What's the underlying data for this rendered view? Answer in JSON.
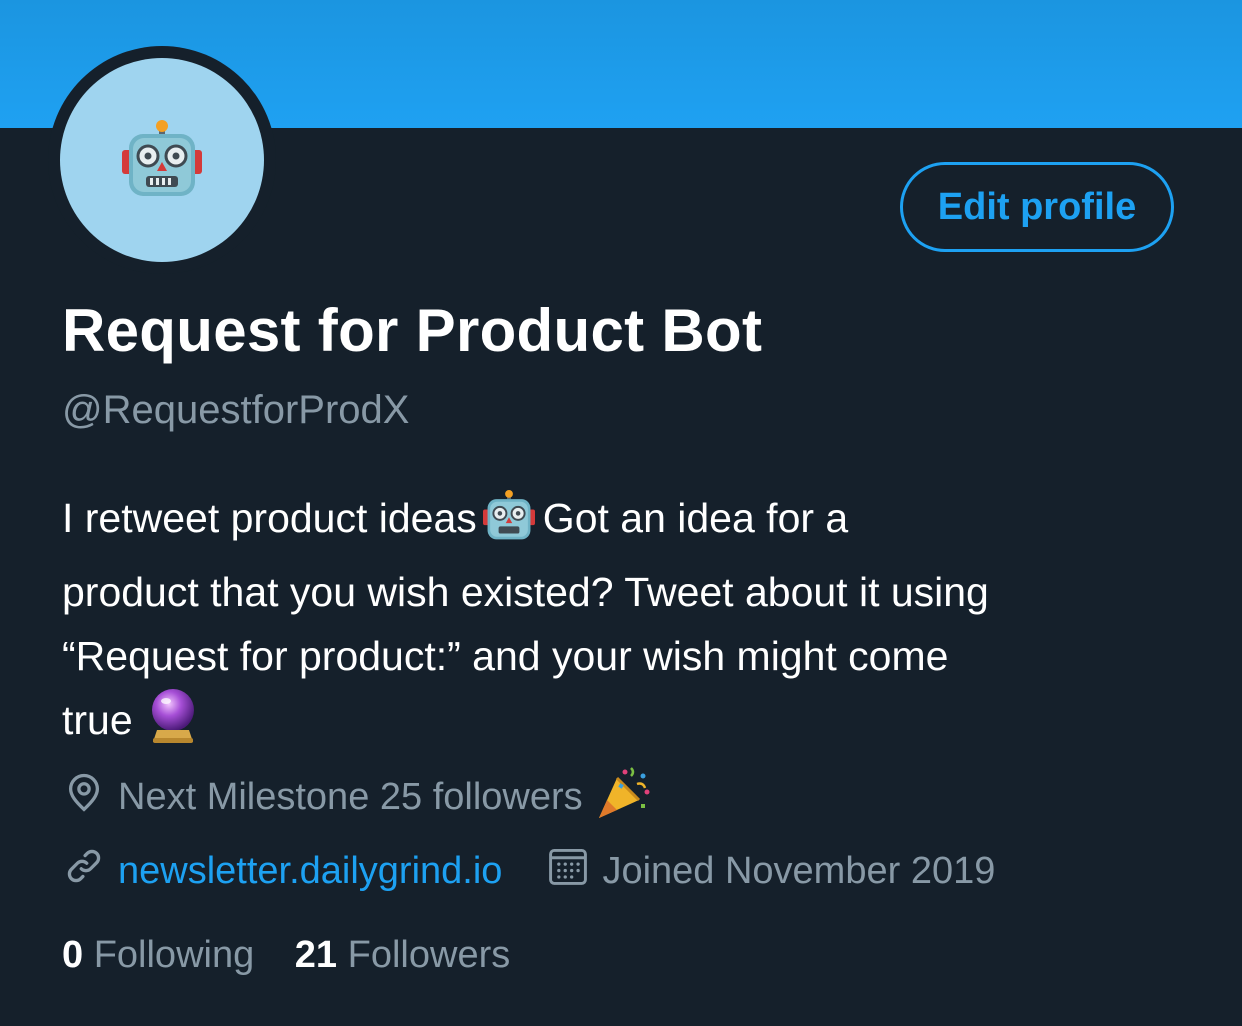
{
  "profile": {
    "name": "Request for Product Bot",
    "handle": "@RequestforProdX",
    "edit_button_label": "Edit profile",
    "avatar_icon": "robot-face-emoji"
  },
  "bio": {
    "line1_before_emoji": "I retweet product ideas",
    "line1_after_emoji": "Got an idea for a",
    "line2": "product that you wish existed? Tweet about it using",
    "line3": "“Request for product:” and your wish might come",
    "line4": "true",
    "emoji_robot": "robot-face",
    "emoji_ball": "crystal-ball"
  },
  "meta": {
    "location": "Next Milestone 25 followers",
    "location_icon": "location-pin-icon",
    "party_emoji": "party-popper",
    "website": "newsletter.dailygrind.io",
    "website_icon": "link-icon",
    "joined": "Joined November 2019",
    "joined_icon": "calendar-icon"
  },
  "stats": {
    "following_count": "0",
    "following_label": "Following",
    "followers_count": "21",
    "followers_label": "Followers"
  },
  "colors": {
    "background": "#15202b",
    "banner": "#1da1f2",
    "accent": "#1da1f2",
    "secondary_text": "#8899a6",
    "avatar_bg": "#9fd4ef"
  }
}
